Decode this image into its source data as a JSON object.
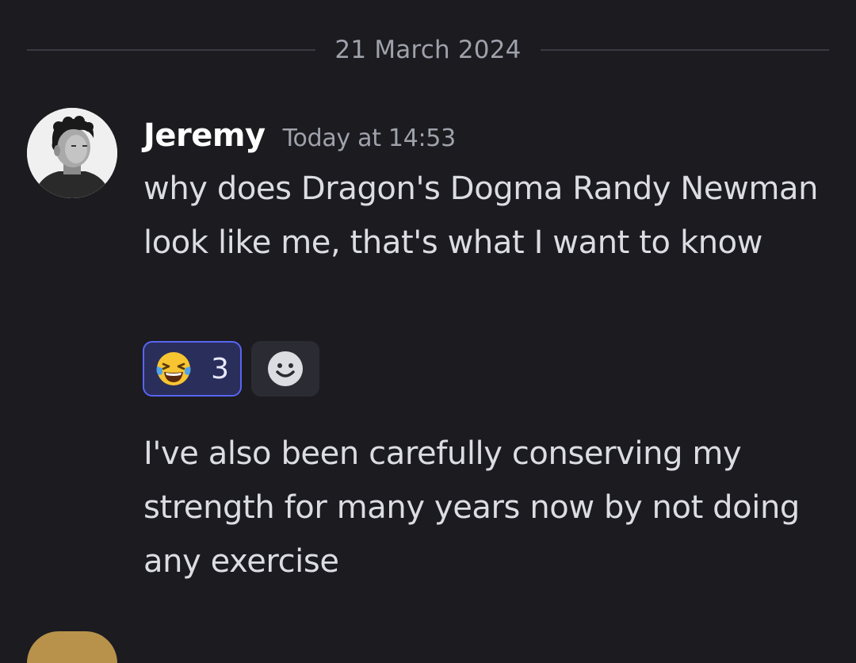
{
  "divider": {
    "date": "21 March 2024"
  },
  "message": {
    "author": "Jeremy",
    "timestamp": "Today at 14:53",
    "text_1": "why does Dragon's Dogma Randy Newman look like me, that's what I want to know",
    "text_2": "I've also been carefully conserving my strength for many years now by not doing any exercise"
  },
  "reactions": [
    {
      "emoji": "face-with-tears-of-joy",
      "count": "3",
      "selected": true
    }
  ],
  "add_reaction": {
    "icon": "smiley-face-icon"
  },
  "colors": {
    "background": "#1b1b20",
    "reaction_accent": "#5865f2",
    "reaction_bg": "#2a2e5a"
  }
}
